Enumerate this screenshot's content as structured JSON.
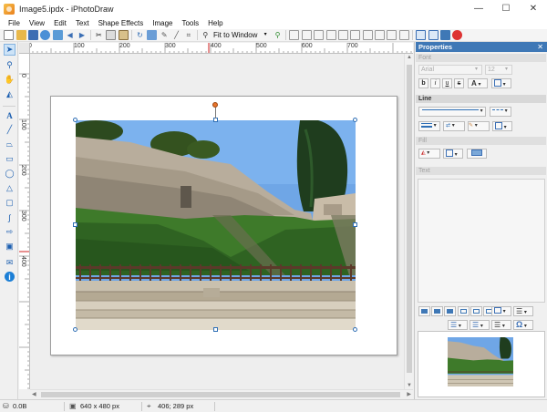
{
  "window": {
    "title": "Image5.ipdx - iPhotoDraw",
    "minimize": "—",
    "maximize": "☐",
    "close": "✕"
  },
  "menu": [
    "File",
    "View",
    "Edit",
    "Text",
    "Shape Effects",
    "Image",
    "Tools",
    "Help"
  ],
  "toolbar": {
    "zoom_label": "Fit to Window"
  },
  "rulers": {
    "top": [
      "0",
      "100",
      "200",
      "300",
      "400",
      "500",
      "600",
      "700"
    ],
    "left": [
      "0",
      "100",
      "200",
      "300",
      "400"
    ]
  },
  "properties": {
    "title": "Properties",
    "close": "✕",
    "font_section": "Font",
    "font_name": "Arial",
    "font_size": "12",
    "bold": "b",
    "italic": "i",
    "underline": "u",
    "strike": "s",
    "line_section": "Line",
    "fill_section": "Fill",
    "text_section": "Text"
  },
  "status": {
    "file_size": "0.0B",
    "image_size": "640 x 480 px",
    "cursor_pos": "406; 289 px"
  }
}
